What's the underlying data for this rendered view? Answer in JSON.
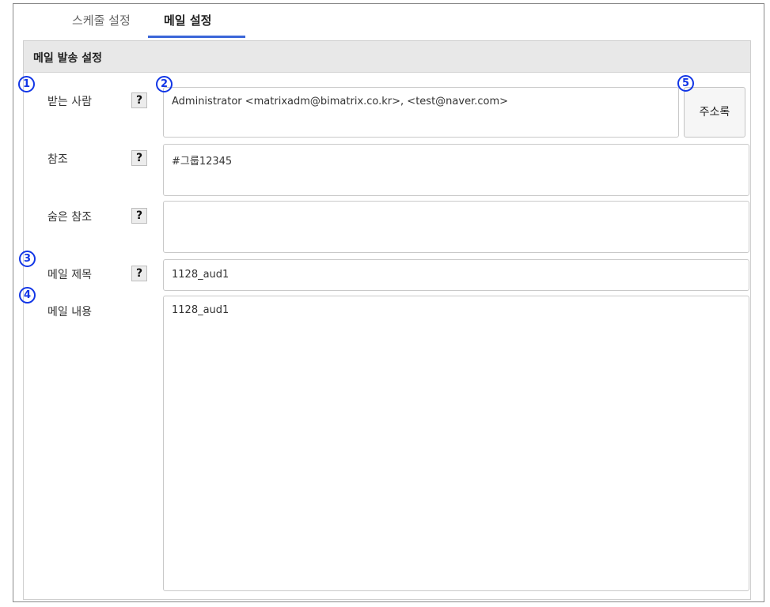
{
  "tabs": [
    {
      "label": "스케줄 설정",
      "active": false
    },
    {
      "label": "메일 설정",
      "active": true
    }
  ],
  "panel": {
    "title": "메일 발송 설정"
  },
  "fields": {
    "to": {
      "label": "받는 사람",
      "value": "Administrator <matrixadm@bimatrix.co.kr>, <test@naver.com>"
    },
    "cc": {
      "label": "참조",
      "value": "#그룹12345"
    },
    "bcc": {
      "label": "숨은 참조",
      "value": ""
    },
    "subject": {
      "label": "메일 제목",
      "value": "1128_aud1"
    },
    "body": {
      "label": "메일 내용",
      "value": "1128_aud1"
    }
  },
  "help_label": "?",
  "address_book_label": "주소록",
  "markers": [
    "1",
    "2",
    "3",
    "4",
    "5"
  ],
  "colors": {
    "accent": "#3b66d8",
    "marker": "#1236e6",
    "header_bg": "#e8e8e8"
  }
}
